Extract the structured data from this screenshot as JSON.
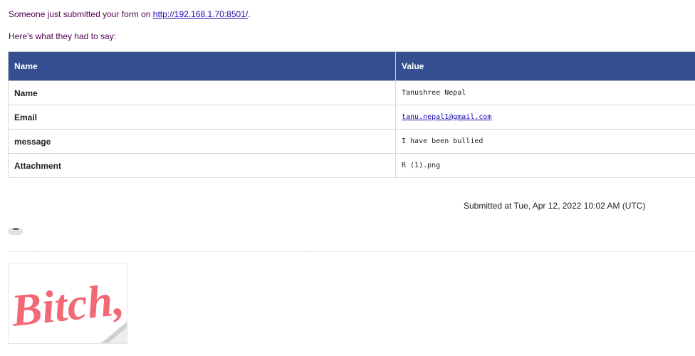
{
  "intro": {
    "text": "Someone just submitted your form on ",
    "link": "http://192.168.1.70:8501/",
    "suffix": "."
  },
  "lead": "Here's what they had to say:",
  "table": {
    "headers": [
      "Name",
      "Value"
    ],
    "rows": [
      {
        "name": "Name",
        "value": "Tanushree Nepal"
      },
      {
        "name": "Email",
        "value": "tanu.nepal1@gmail.com"
      },
      {
        "name": "message",
        "value": "I have been bullied"
      },
      {
        "name": "Attachment",
        "value": "R (1).png"
      }
    ]
  },
  "submitted": "Submitted at Tue, Apr 12, 2022 10:02 AM (UTC)",
  "trim_label": "•••",
  "attachment_image_text": "Bitch,",
  "colors": {
    "header_bg": "#354f91",
    "link": "#1a0dab",
    "intro_text": "#500050",
    "attachment_text": "#f0505f"
  }
}
